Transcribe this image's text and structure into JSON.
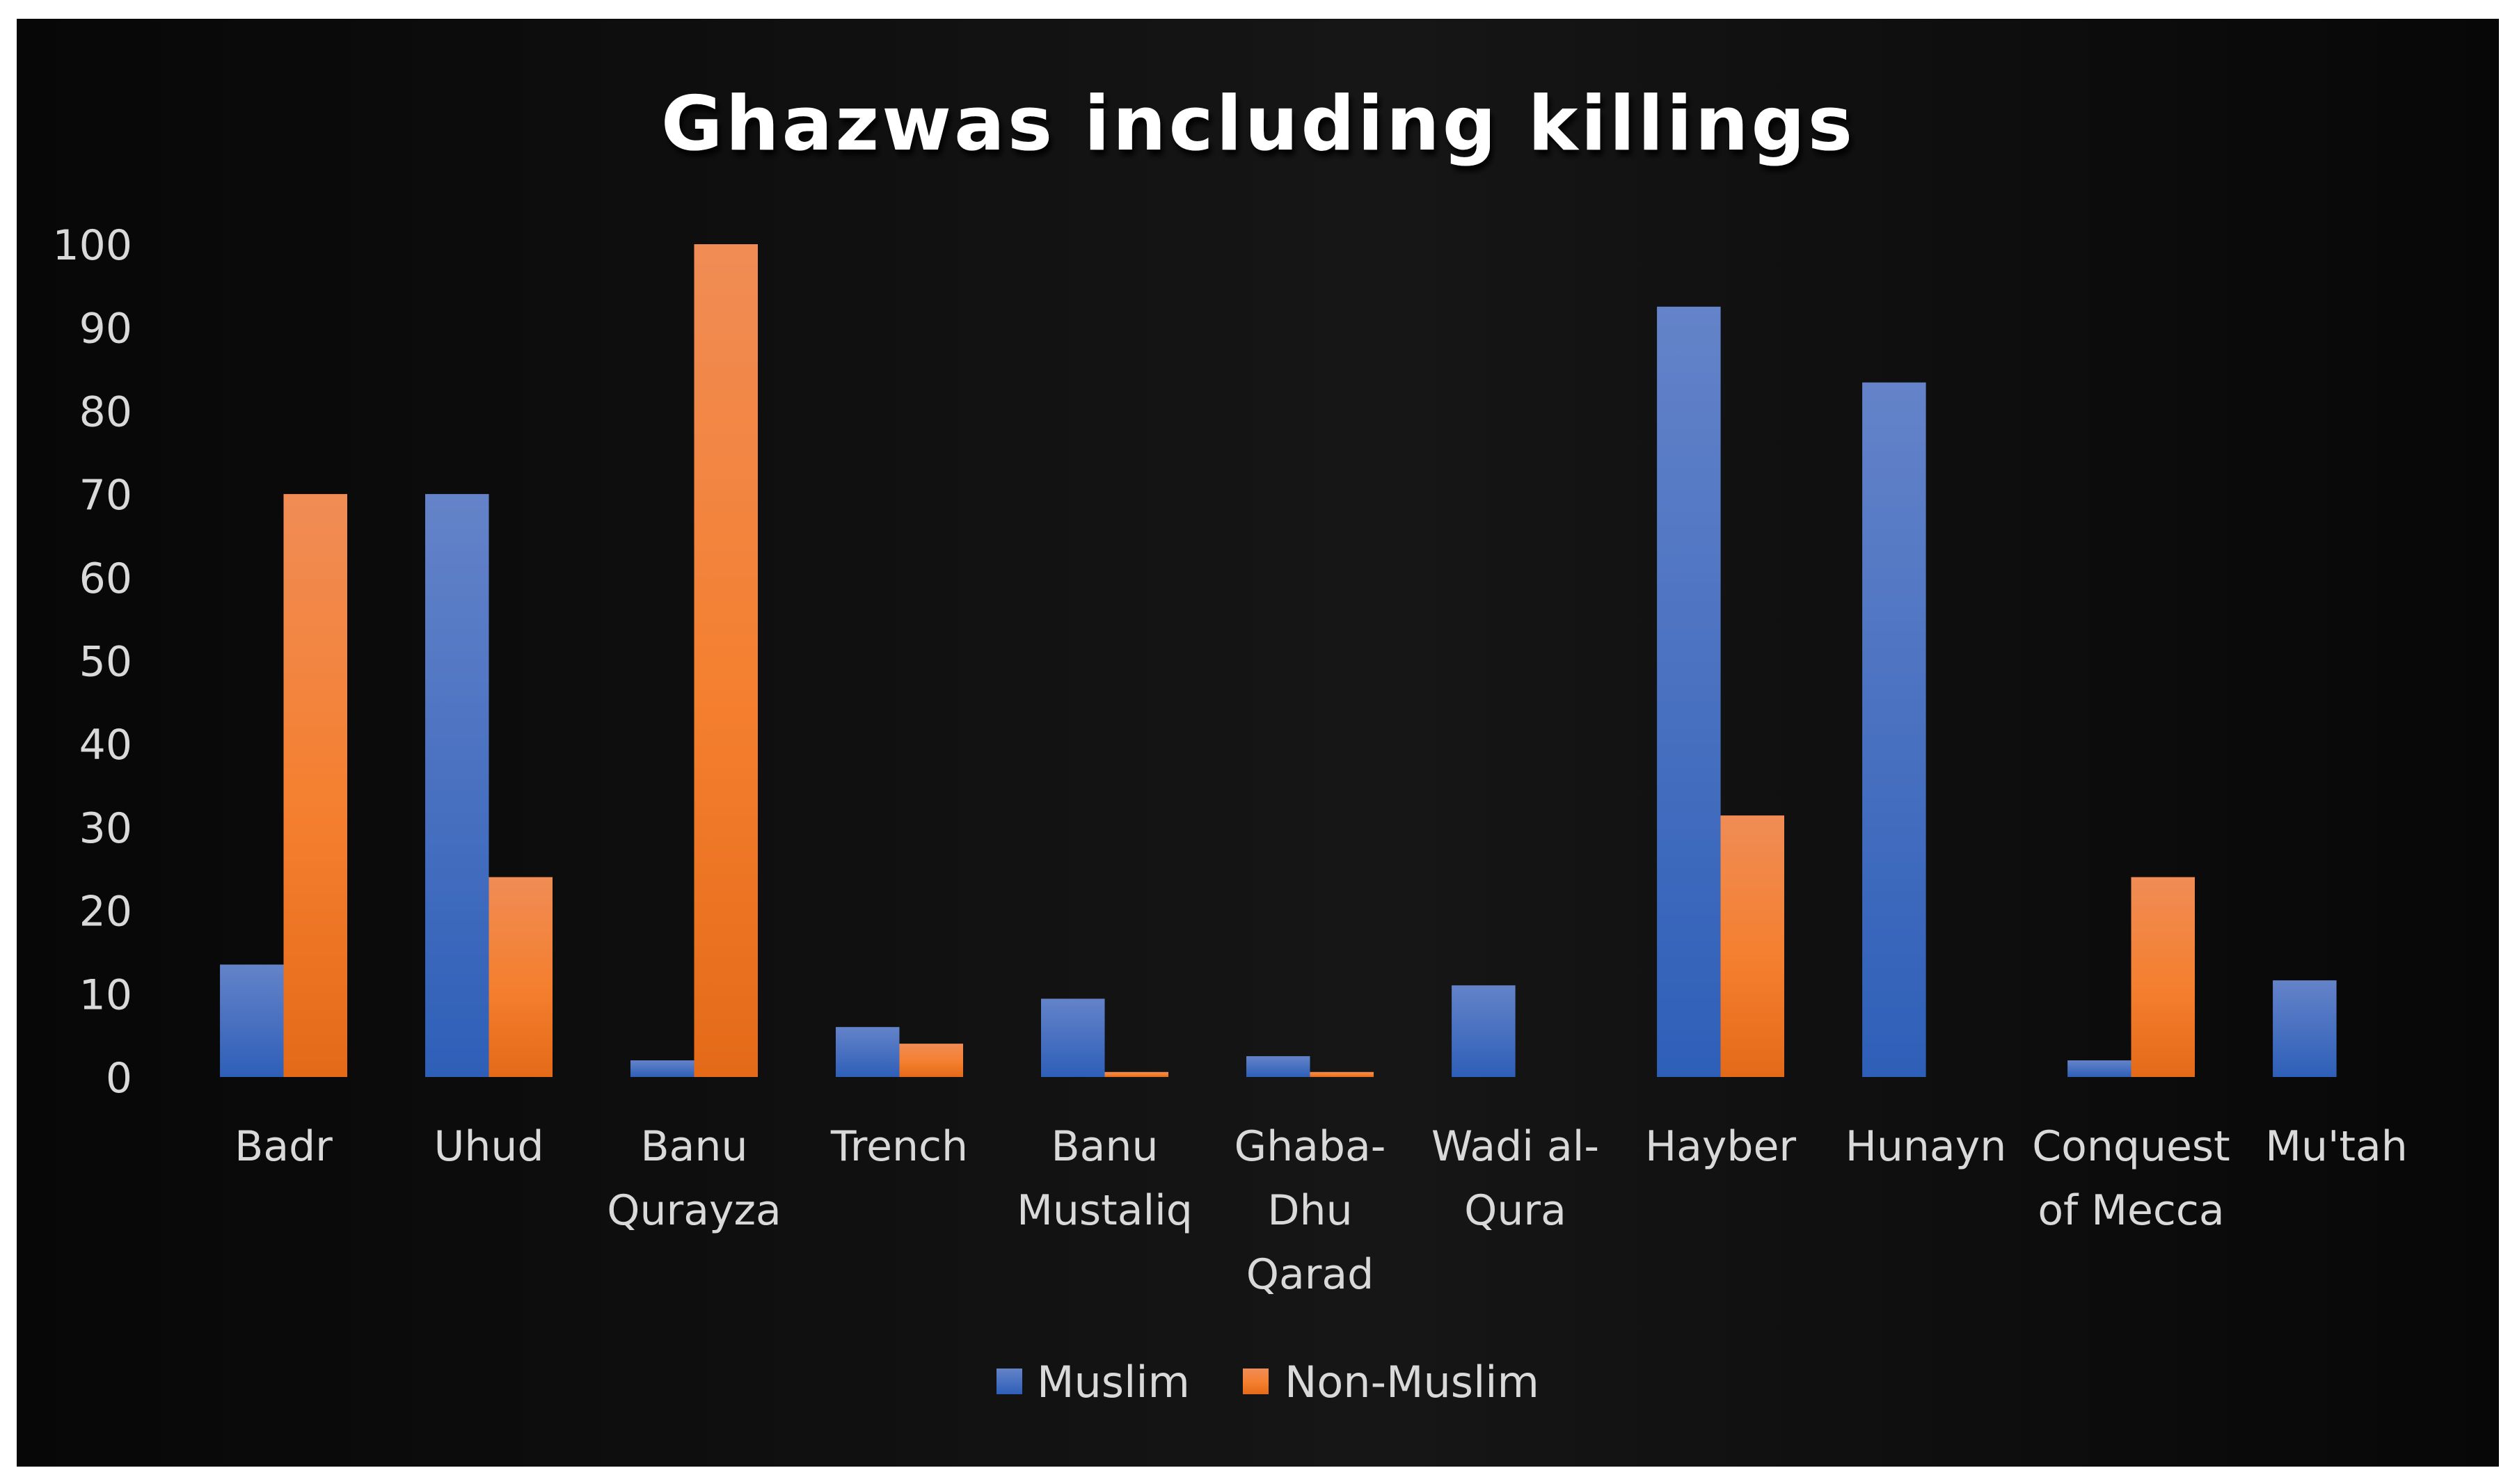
{
  "chart_data": {
    "type": "bar",
    "title": "Ghazwas including killings",
    "xlabel": "",
    "ylabel": "",
    "ylim": [
      0,
      100
    ],
    "yticks": [
      0,
      10,
      20,
      30,
      40,
      50,
      60,
      70,
      80,
      90,
      100
    ],
    "grid": false,
    "legend_position": "bottom",
    "categories": [
      [
        "Badr"
      ],
      [
        "Uhud"
      ],
      [
        "Banu",
        "Qurayza"
      ],
      [
        "Trench"
      ],
      [
        "Banu",
        "Mustaliq"
      ],
      [
        "Ghaba-",
        "Dhu",
        "Qarad"
      ],
      [
        "Wadi al-",
        "Qura"
      ],
      [
        "Hayber"
      ],
      [
        "Hunayn"
      ],
      [
        "Conquest",
        "of Mecca"
      ],
      [
        "Mu'tah"
      ]
    ],
    "series": [
      {
        "name": "Muslim",
        "color": "#4472c4",
        "color_light": "#6483c9",
        "color_dark": "#2e5fb8",
        "values": [
          13.5,
          70,
          2,
          6,
          9.4,
          2.5,
          11,
          92.5,
          83.4,
          2,
          11.6
        ]
      },
      {
        "name": "Non-Muslim",
        "color": "#ed7d31",
        "color_light": "#f08c55",
        "color_dark": "#e46a18",
        "values": [
          70,
          24,
          100,
          4,
          0.6,
          0.6,
          0,
          31.4,
          0,
          24,
          0
        ]
      }
    ]
  },
  "style": {
    "background_outer": "#ffffff",
    "background_chart_dark": "#080808",
    "background_chart_mid": "#151515",
    "text_color": "#d9d9d9",
    "title_color": "#ffffff"
  }
}
